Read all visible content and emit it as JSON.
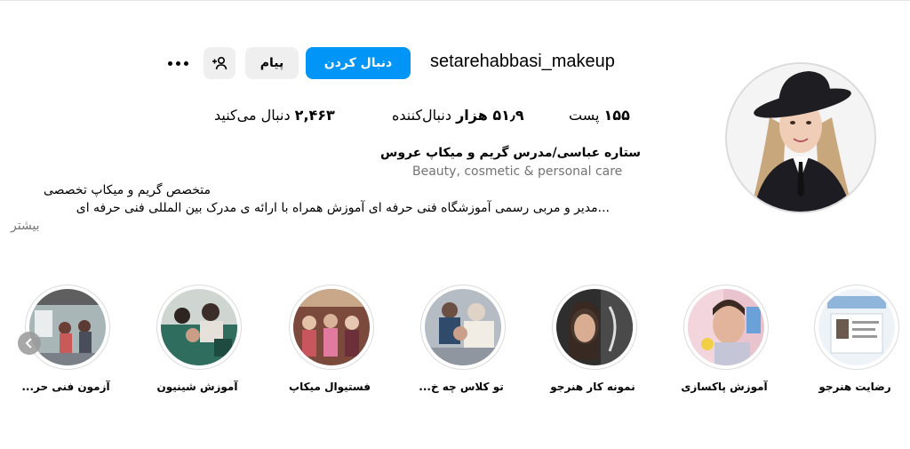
{
  "profile": {
    "username": "setarehabbasi_makeup",
    "follow_label": "دنبال کردن",
    "message_label": "پیام",
    "stats": {
      "posts_count": "۱۵۵",
      "posts_label": "پست",
      "followers_count": "۵۱٫۹ هزار",
      "followers_label": "دنبال‌کننده",
      "following_count": "۲,۴۶۳",
      "following_label": "دنبال می‌کنید"
    },
    "full_name": "ستاره عباسی/مدرس گریم و میکاپ عروس",
    "category": "Beauty, cosmetic & personal care",
    "bio_line1": "متخصص گریم و میکاپ تخصصی",
    "bio_line2": "...مدیر و مربی رسمی آموزشگاه فنی حرفه ای آموزش همراه با ارائه ی مدرک بین المللی فنی حرفه ای",
    "more_label": "بیشتر"
  },
  "highlights": [
    {
      "label": "رضایت هنرجو",
      "color": "#cfe0f2"
    },
    {
      "label": "آموزش پاکسازی",
      "color": "#e9c4cf"
    },
    {
      "label": "نمونه کار هنرجو",
      "color": "#3a3a3a"
    },
    {
      "label": "تو کلاس چه خ...",
      "color": "#9aa5b0"
    },
    {
      "label": "فستیوال میکاپ",
      "color": "#c86a7a"
    },
    {
      "label": "آموزش شینیون",
      "color": "#5f7f74"
    },
    {
      "label": "آزمون فنی حر...",
      "color": "#7a8c8e"
    }
  ],
  "icons": {
    "more": "more-options-icon",
    "suggest": "person-add-icon",
    "scroll": "chevron-left-icon"
  },
  "colors": {
    "accent": "#0095f6",
    "secondary_button": "#efefef",
    "muted_text": "#737373"
  }
}
